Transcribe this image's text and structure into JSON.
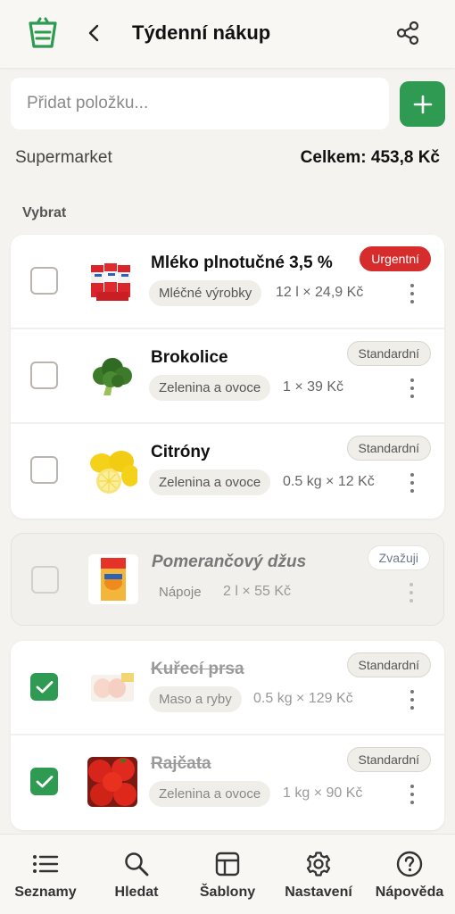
{
  "header": {
    "title": "Týdenní nákup",
    "logo_icon": "shopping-basket-icon",
    "back_icon": "chevron-left-icon",
    "share_icon": "share-icon"
  },
  "search": {
    "placeholder": "Přidat položku..."
  },
  "summary": {
    "store": "Supermarket",
    "total": "Celkem: 453,8 Kč"
  },
  "section": {
    "label": "Vybrat"
  },
  "items": [
    {
      "name": "Mléko plnotučné 3,5 %",
      "category": "Mléčné výrobky",
      "quantity": "12 l × 24,9 Kč",
      "priority": "Urgentní",
      "checked": false
    },
    {
      "name": "Brokolice",
      "category": "Zelenina a ovoce",
      "quantity": "1 × 39 Kč",
      "priority": "Standardní",
      "checked": false
    },
    {
      "name": "Citróny",
      "category": "Zelenina a ovoce",
      "quantity": "0.5 kg × 12 Kč",
      "priority": "Standardní",
      "checked": false
    },
    {
      "name": "Pomerančový džus",
      "category": "Nápoje",
      "quantity": "2 l × 55 Kč",
      "priority": "Zvažuji",
      "checked": false
    },
    {
      "name": "Kuřecí prsa",
      "category": "Maso a ryby",
      "quantity": "0.5 kg × 129 Kč",
      "priority": "Standardní",
      "checked": true
    },
    {
      "name": "Rajčata",
      "category": "Zelenina a ovoce",
      "quantity": "1 kg × 90 Kč",
      "priority": "Standardní",
      "checked": true
    }
  ],
  "nav": [
    {
      "label": "Seznamy",
      "icon": "list-icon"
    },
    {
      "label": "Hledat",
      "icon": "search-icon"
    },
    {
      "label": "Šablony",
      "icon": "template-icon"
    },
    {
      "label": "Nastavení",
      "icon": "gear-icon"
    },
    {
      "label": "Nápověda",
      "icon": "help-icon"
    }
  ],
  "colors": {
    "accent": "#2f9a52",
    "urgent": "#d62c2c",
    "background": "#f4f3ef"
  }
}
